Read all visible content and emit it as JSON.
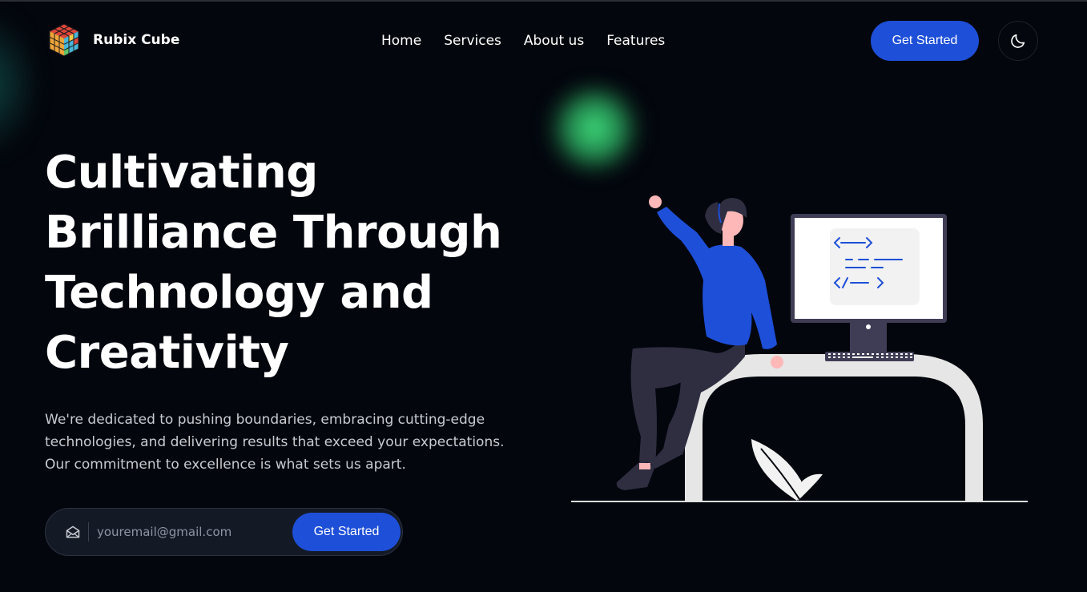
{
  "brand": {
    "name": "Rubix Cube",
    "logo_icon": "rubiks-cube-icon"
  },
  "nav": {
    "items": [
      {
        "label": "Home"
      },
      {
        "label": "Services"
      },
      {
        "label": "About us"
      },
      {
        "label": "Features"
      }
    ],
    "cta_label": "Get Started",
    "theme_toggle_icon": "moon-icon"
  },
  "hero": {
    "title_lines": [
      "Cultivating",
      "Brilliance Through",
      "Technology and",
      "Creativity"
    ],
    "subtitle": "We're dedicated to pushing boundaries, embracing cutting-edge technologies, and delivering results that exceed your expectations. Our commitment to excellence is what sets us apart.",
    "email_placeholder": "youremail@gmail.com",
    "email_icon": "envelope-open-icon",
    "submit_label": "Get Started",
    "illustration": "woman-sitting-on-desk-with-code-monitor-illustration"
  },
  "colors": {
    "background": "#03060d",
    "accent": "#1e4fd8",
    "glow": "#3cd678",
    "text": "#ffffff",
    "muted_text": "#c8cbd2"
  }
}
